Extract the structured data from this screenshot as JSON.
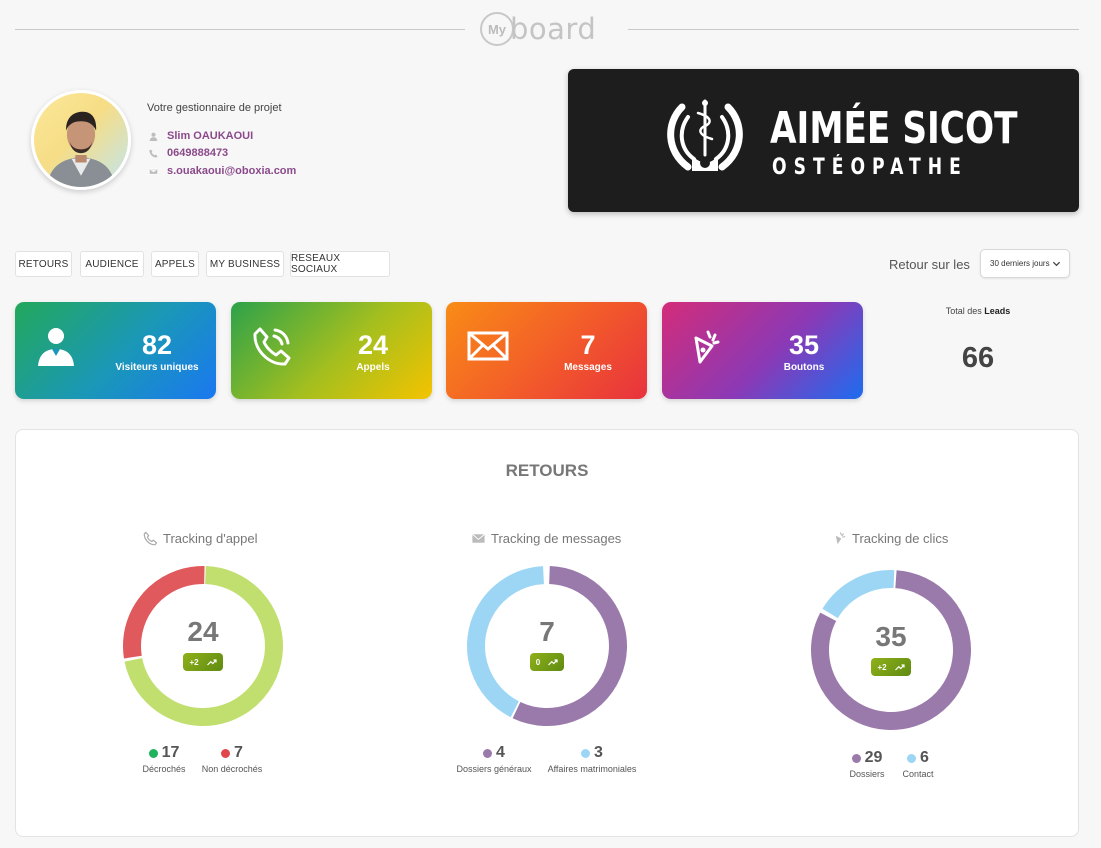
{
  "header": {
    "logo_my": "My",
    "logo_board": "board"
  },
  "manager": {
    "title": "Votre gestionnaire de projet",
    "name": "Slim OAUKAOUI",
    "phone": "0649888473",
    "email": "s.ouakaoui@oboxia.com"
  },
  "brand": {
    "name": "AIMÉE SICOT",
    "subtitle": "OSTÉOPATHE"
  },
  "tabs": [
    "RETOURS",
    "AUDIENCE",
    "APPELS",
    "MY BUSINESS",
    "RESEAUX SOCIAUX"
  ],
  "period": {
    "label": "Retour sur les",
    "selected": "30 derniers jours"
  },
  "stats": [
    {
      "value": "82",
      "label": "Visiteurs uniques",
      "icon": "user-icon"
    },
    {
      "value": "24",
      "label": "Appels",
      "icon": "phone-icon"
    },
    {
      "value": "7",
      "label": "Messages",
      "icon": "envelope-icon"
    },
    {
      "value": "35",
      "label": "Boutons",
      "icon": "click-icon"
    }
  ],
  "total": {
    "label_prefix": "Total des ",
    "label_bold": "Leads",
    "value": "66"
  },
  "panel": {
    "title": "RETOURS",
    "trackers": [
      {
        "title": "Tracking d'appel",
        "icon": "phone-icon",
        "value": "24",
        "badge": "+2",
        "legend": [
          {
            "value": "17",
            "name": "Décrochés",
            "color": "#1fb35e"
          },
          {
            "value": "7",
            "name": "Non décrochés",
            "color": "#e0474c"
          }
        ]
      },
      {
        "title": "Tracking de messages",
        "icon": "envelope-icon",
        "value": "7",
        "badge": "0",
        "legend": [
          {
            "value": "4",
            "name": "Dossiers généraux",
            "color": "#9a79ab"
          },
          {
            "value": "3",
            "name": "Affaires matrimoniales",
            "color": "#9dd6f5"
          }
        ]
      },
      {
        "title": "Tracking de clics",
        "icon": "click-icon",
        "value": "35",
        "badge": "+2",
        "legend": [
          {
            "value": "29",
            "name": "Dossiers",
            "color": "#9a79ab"
          },
          {
            "value": "6",
            "name": "Contact",
            "color": "#9dd6f5"
          }
        ]
      }
    ]
  },
  "colors": {
    "call_answered": "#c1df6e",
    "call_missed": "#e0595c",
    "purple": "#9a79ab",
    "lightblue": "#9dd6f5"
  }
}
